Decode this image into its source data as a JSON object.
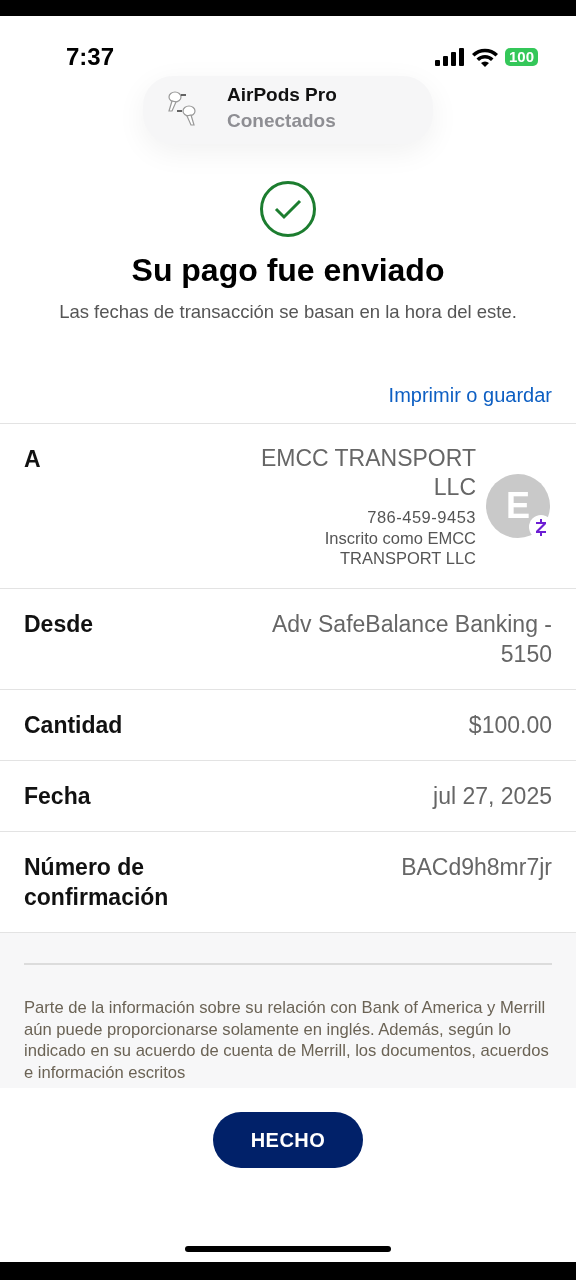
{
  "status_bar": {
    "time": "7:37",
    "battery": "100"
  },
  "notification": {
    "title": "AirPods Pro",
    "subtitle": "Conectados"
  },
  "header": {
    "title": "Su pago fue enviado",
    "subtitle": "Las fechas de transacción se basan en la hora del este."
  },
  "print_link": "Imprimir o guardar",
  "details": [
    {
      "kind": "recipient",
      "label": "A",
      "name": "EMCC TRANSPORT LLC",
      "phone": "786-459-9453",
      "enrolled_as": "Inscrito como EMCC TRANSPORT LLC",
      "avatar_initial": "E"
    },
    {
      "kind": "plain",
      "label": "Desde",
      "value": "Adv SafeBalance Banking - 5150"
    },
    {
      "kind": "plain",
      "label": "Cantidad",
      "value": "$100.00"
    },
    {
      "kind": "plain",
      "label": "Fecha",
      "value": "jul 27, 2025"
    },
    {
      "kind": "plain",
      "label": "Número de confirmación",
      "value": "BACd9h8mr7jr"
    }
  ],
  "disclaimer": "Parte de la información sobre su relación con Bank of America y Merrill aún puede proporcionarse solamente en inglés. Además, según lo indicado en su acuerdo de cuenta de Merrill, los documentos, acuerdos e información escritos",
  "done_button": "HECHO"
}
